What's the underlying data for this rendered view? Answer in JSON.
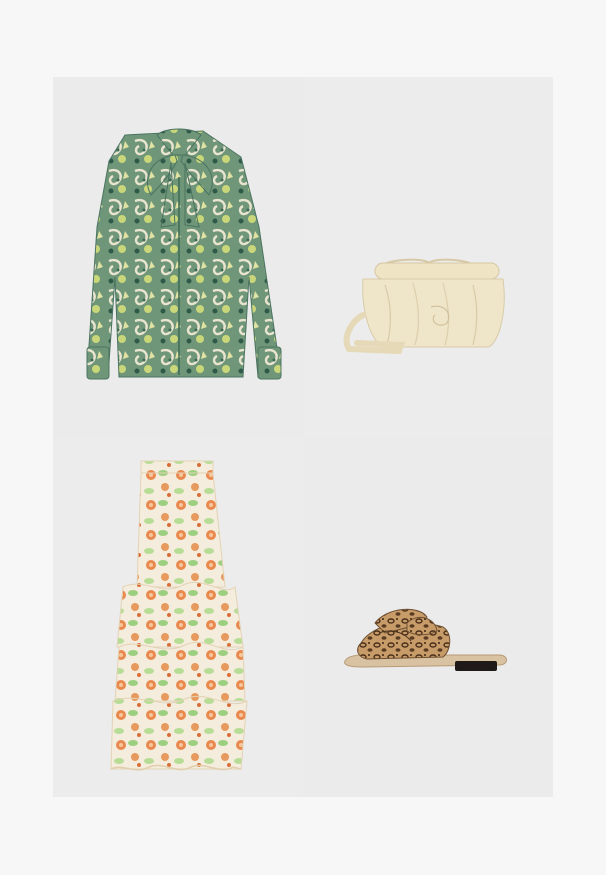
{
  "outfit": {
    "items": [
      {
        "name": "paisley-print-blouse-with-neck-bow",
        "colors": [
          "#5f8a6a",
          "#c9d77a",
          "#e9e4cf",
          "#2f5a4a"
        ]
      },
      {
        "name": "cream-leather-clutch-bag",
        "colors": [
          "#efe5c8",
          "#d9ccab"
        ]
      },
      {
        "name": "floral-ruffle-maxi-skirt",
        "colors": [
          "#f3ead8",
          "#e9894e",
          "#9ccf7f",
          "#e5b07e"
        ]
      },
      {
        "name": "leopard-knot-slide-sandal",
        "colors": [
          "#c89c69",
          "#5a3c24",
          "#e9d8c0"
        ]
      }
    ]
  }
}
